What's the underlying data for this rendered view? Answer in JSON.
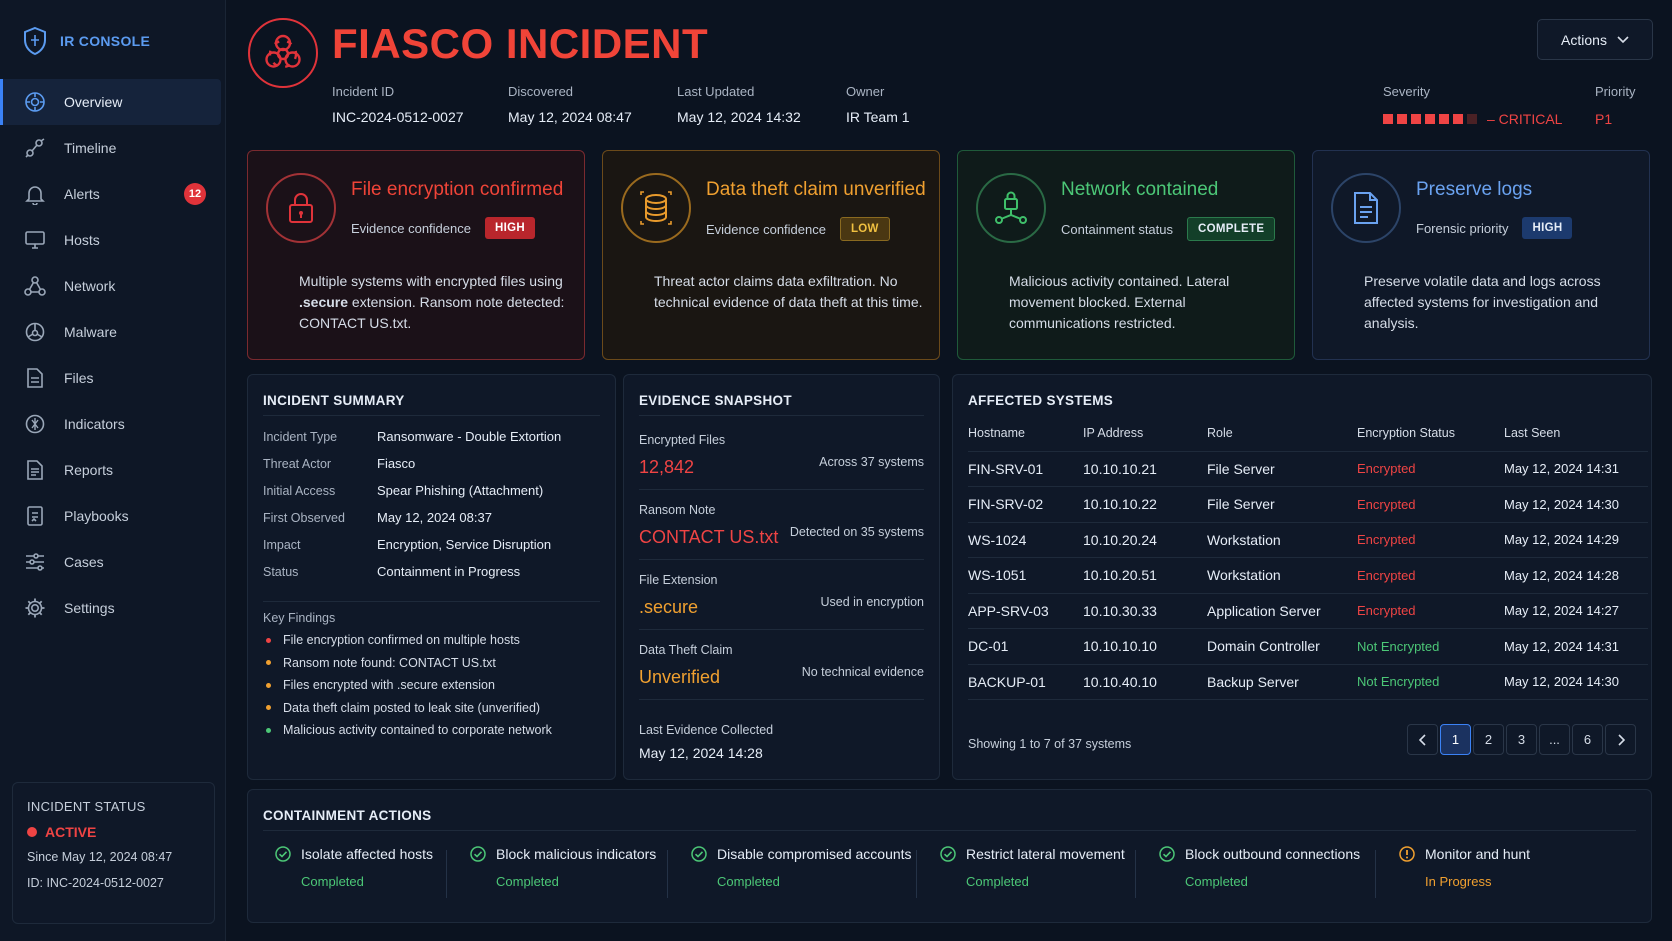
{
  "brand": {
    "name": "IR CONSOLE"
  },
  "nav": [
    {
      "label": "Overview",
      "icon": "overview-icon",
      "active": true
    },
    {
      "label": "Timeline",
      "icon": "timeline-icon"
    },
    {
      "label": "Alerts",
      "icon": "bell-icon",
      "badge": "12"
    },
    {
      "label": "Hosts",
      "icon": "monitor-icon"
    },
    {
      "label": "Network",
      "icon": "network-icon"
    },
    {
      "label": "Malware",
      "icon": "malware-icon"
    },
    {
      "label": "Files",
      "icon": "file-icon"
    },
    {
      "label": "Indicators",
      "icon": "indicator-icon"
    },
    {
      "label": "Reports",
      "icon": "report-icon"
    },
    {
      "label": "Playbooks",
      "icon": "playbook-icon"
    },
    {
      "label": "Cases",
      "icon": "cases-icon"
    },
    {
      "label": "Settings",
      "icon": "gear-icon"
    }
  ],
  "incident_status": {
    "title": "INCIDENT STATUS",
    "state": "ACTIVE",
    "since": "Since May 12, 2024 08:47",
    "id_line": "ID: INC-2024-0512-0027"
  },
  "header": {
    "title": "FIASCO INCIDENT",
    "actions_label": "Actions",
    "meta": {
      "incident_id_label": "Incident ID",
      "incident_id": "INC-2024-0512-0027",
      "discovered_label": "Discovered",
      "discovered": "May 12, 2024 08:47",
      "updated_label": "Last Updated",
      "updated": "May 12, 2024 14:32",
      "owner_label": "Owner",
      "owner": "IR Team 1",
      "severity_label": "Severity",
      "severity": "– CRITICAL",
      "severity_level": 6,
      "severity_max": 7,
      "priority_label": "Priority",
      "priority": "P1"
    }
  },
  "cards": {
    "encryption": {
      "title": "File encryption confirmed",
      "field": "Evidence confidence",
      "pill": "HIGH",
      "desc_pre": "Multiple systems with encrypted files using ",
      "desc_strong": ".secure",
      "desc_post": " extension. Ransom note detected: CONTACT US.txt."
    },
    "theft": {
      "title": "Data theft claim unverified",
      "field": "Evidence confidence",
      "pill": "LOW",
      "desc": "Threat actor claims data exfiltration. No technical evidence of data theft at this time."
    },
    "network": {
      "title": "Network contained",
      "field": "Containment status",
      "pill": "COMPLETE",
      "desc": "Malicious activity contained. Lateral movement blocked. External communications restricted."
    },
    "logs": {
      "title": "Preserve logs",
      "field": "Forensic priority",
      "pill": "HIGH",
      "desc": "Preserve volatile data and logs across affected systems for investigation and analysis."
    }
  },
  "summary": {
    "title": "INCIDENT SUMMARY",
    "rows": [
      {
        "k": "Incident Type",
        "v": "Ransomware - Double Extortion"
      },
      {
        "k": "Threat Actor",
        "v": "Fiasco"
      },
      {
        "k": "Initial Access",
        "v": "Spear Phishing (Attachment)"
      },
      {
        "k": "First Observed",
        "v": "May 12, 2024 08:37"
      },
      {
        "k": "Impact",
        "v": "Encryption, Service Disruption"
      },
      {
        "k": "Status",
        "v": "Containment in Progress"
      }
    ],
    "findings_title": "Key Findings",
    "findings": [
      {
        "text": "File encryption confirmed on multiple hosts",
        "color": "#ef4444"
      },
      {
        "text": "Ransom note found: CONTACT US.txt",
        "color": "#f0a030"
      },
      {
        "text": "Files encrypted with .secure extension",
        "color": "#f0a030"
      },
      {
        "text": "Data theft claim posted to leak site (unverified)",
        "color": "#f0a030"
      },
      {
        "text": "Malicious activity contained to corporate network",
        "color": "#4cc777"
      }
    ]
  },
  "evidence": {
    "title": "EVIDENCE SNAPSHOT",
    "items": [
      {
        "label": "Encrypted Files",
        "value": "12,842",
        "note": "Across 37 systems",
        "color": "#ef4444"
      },
      {
        "label": "Ransom Note",
        "value": "CONTACT US.txt",
        "note": "Detected on 35 systems",
        "color": "#ef4444"
      },
      {
        "label": "File Extension",
        "value": ".secure",
        "note": "Used in encryption",
        "color": "#f0a030"
      },
      {
        "label": "Data Theft Claim",
        "value": "Unverified",
        "note": "No technical evidence",
        "color": "#f0a030"
      }
    ],
    "last_label": "Last Evidence Collected",
    "last_value": "May 12, 2024 14:28"
  },
  "affected": {
    "title": "AFFECTED SYSTEMS",
    "headers": [
      "Hostname",
      "IP Address",
      "Role",
      "Encryption Status",
      "Last Seen"
    ],
    "rows": [
      [
        "FIN-SRV-01",
        "10.10.10.21",
        "File Server",
        "Encrypted",
        "May 12, 2024 14:31"
      ],
      [
        "FIN-SRV-02",
        "10.10.10.22",
        "File Server",
        "Encrypted",
        "May 12, 2024 14:30"
      ],
      [
        "WS-1024",
        "10.10.20.24",
        "Workstation",
        "Encrypted",
        "May 12, 2024 14:29"
      ],
      [
        "WS-1051",
        "10.10.20.51",
        "Workstation",
        "Encrypted",
        "May 12, 2024 14:28"
      ],
      [
        "APP-SRV-03",
        "10.10.30.33",
        "Application Server",
        "Encrypted",
        "May 12, 2024 14:27"
      ],
      [
        "DC-01",
        "10.10.10.10",
        "Domain Controller",
        "Not Encrypted",
        "May 12, 2024 14:31"
      ],
      [
        "BACKUP-01",
        "10.10.40.10",
        "Backup Server",
        "Not Encrypted",
        "May 12, 2024 14:30"
      ]
    ],
    "showing": "Showing 1 to 7 of 37 systems",
    "pages": [
      "1",
      "2",
      "3",
      "...",
      "6"
    ],
    "current_page": "1"
  },
  "containment": {
    "title": "CONTAINMENT ACTIONS",
    "actions": [
      {
        "name": "Isolate affected hosts",
        "status": "Completed",
        "done": true
      },
      {
        "name": "Block malicious indicators",
        "status": "Completed",
        "done": true
      },
      {
        "name": "Disable compromised accounts",
        "status": "Completed",
        "done": true
      },
      {
        "name": "Restrict lateral movement",
        "status": "Completed",
        "done": true
      },
      {
        "name": "Block outbound connections",
        "status": "Completed",
        "done": true
      },
      {
        "name": "Monitor and hunt",
        "status": "In Progress",
        "done": false
      }
    ]
  }
}
